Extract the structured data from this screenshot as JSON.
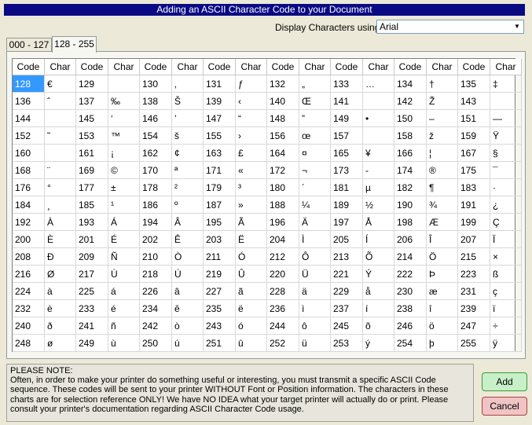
{
  "title": "Adding an ASCII Character Code to your Document",
  "display_label": "Display Characters using:",
  "font_value": "Arial",
  "tabs": [
    {
      "label": "000 - 127"
    },
    {
      "label": "128 - 255"
    }
  ],
  "table": {
    "headers": [
      "Code",
      "Char",
      "Code",
      "Char",
      "Code",
      "Char",
      "Code",
      "Char",
      "Code",
      "Char",
      "Code",
      "Char",
      "Code",
      "Char",
      "Code",
      "Char"
    ],
    "rows": [
      [
        "128",
        "€",
        "129",
        "",
        "130",
        "‚",
        "131",
        "ƒ",
        "132",
        "„",
        "133",
        "…",
        "134",
        "†",
        "135",
        "‡"
      ],
      [
        "136",
        "ˆ",
        "137",
        "‰",
        "138",
        "Š",
        "139",
        "‹",
        "140",
        "Œ",
        "141",
        "",
        "142",
        "Ž",
        "143",
        ""
      ],
      [
        "144",
        "",
        "145",
        "‘",
        "146",
        "’",
        "147",
        "“",
        "148",
        "”",
        "149",
        "•",
        "150",
        "–",
        "151",
        "—"
      ],
      [
        "152",
        "˜",
        "153",
        "™",
        "154",
        "š",
        "155",
        "›",
        "156",
        "œ",
        "157",
        "",
        "158",
        "ž",
        "159",
        "Ÿ"
      ],
      [
        "160",
        "",
        "161",
        "¡",
        "162",
        "¢",
        "163",
        "£",
        "164",
        "¤",
        "165",
        "¥",
        "166",
        "¦",
        "167",
        "§"
      ],
      [
        "168",
        "¨",
        "169",
        "©",
        "170",
        "ª",
        "171",
        "«",
        "172",
        "¬",
        "173",
        "-",
        "174",
        "®",
        "175",
        "¯"
      ],
      [
        "176",
        "°",
        "177",
        "±",
        "178",
        "²",
        "179",
        "³",
        "180",
        "´",
        "181",
        "µ",
        "182",
        "¶",
        "183",
        "·"
      ],
      [
        "184",
        "¸",
        "185",
        "¹",
        "186",
        "º",
        "187",
        "»",
        "188",
        "¼",
        "189",
        "½",
        "190",
        "¾",
        "191",
        "¿"
      ],
      [
        "192",
        "À",
        "193",
        "Á",
        "194",
        "Â",
        "195",
        "Ã",
        "196",
        "Ä",
        "197",
        "Å",
        "198",
        "Æ",
        "199",
        "Ç"
      ],
      [
        "200",
        "È",
        "201",
        "É",
        "202",
        "Ê",
        "203",
        "Ë",
        "204",
        "Ì",
        "205",
        "Í",
        "206",
        "Î",
        "207",
        "Ï"
      ],
      [
        "208",
        "Ð",
        "209",
        "Ñ",
        "210",
        "Ò",
        "211",
        "Ó",
        "212",
        "Ô",
        "213",
        "Õ",
        "214",
        "Ö",
        "215",
        "×"
      ],
      [
        "216",
        "Ø",
        "217",
        "Ù",
        "218",
        "Ú",
        "219",
        "Û",
        "220",
        "Ü",
        "221",
        "Ý",
        "222",
        "Þ",
        "223",
        "ß"
      ],
      [
        "224",
        "à",
        "225",
        "á",
        "226",
        "â",
        "227",
        "ã",
        "228",
        "ä",
        "229",
        "å",
        "230",
        "æ",
        "231",
        "ç"
      ],
      [
        "232",
        "è",
        "233",
        "é",
        "234",
        "ê",
        "235",
        "ë",
        "236",
        "ì",
        "237",
        "í",
        "238",
        "î",
        "239",
        "ï"
      ],
      [
        "240",
        "ð",
        "241",
        "ñ",
        "242",
        "ò",
        "243",
        "ó",
        "244",
        "ô",
        "245",
        "õ",
        "246",
        "ö",
        "247",
        "÷"
      ],
      [
        "248",
        "ø",
        "249",
        "ù",
        "250",
        "ú",
        "251",
        "û",
        "252",
        "ü",
        "253",
        "ý",
        "254",
        "þ",
        "255",
        "ÿ"
      ]
    ]
  },
  "note": {
    "heading": "PLEASE NOTE:",
    "body": "Often, in order to make your printer do something useful or interesting, you must transmit a specific ASCII Code sequence.  These codes will be sent to your printer WITHOUT Font or Position information.  The characters in these charts are for selection reference ONLY!  We have NO IDEA what your target printer will actually do or print.  Please consult your printer's documentation regarding ASCII Character Code usage."
  },
  "buttons": {
    "add": "Add",
    "cancel": "Cancel"
  }
}
